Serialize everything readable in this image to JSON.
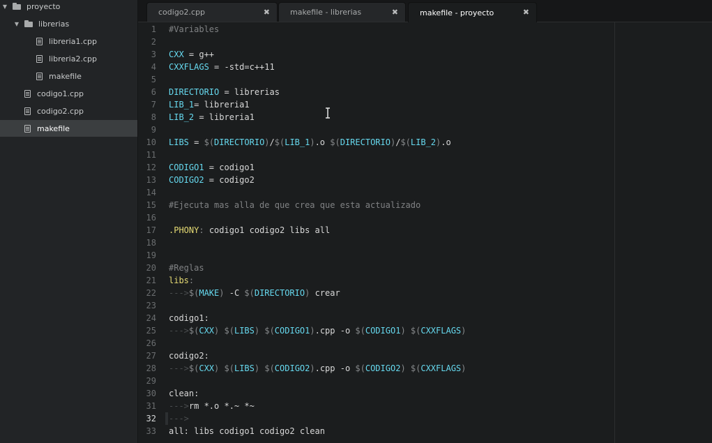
{
  "sidebar": {
    "items": [
      {
        "label": "proyecto",
        "type": "folder",
        "expanded": true,
        "depth": 0
      },
      {
        "label": "librerias",
        "type": "folder",
        "expanded": true,
        "depth": 1
      },
      {
        "label": "libreria1.cpp",
        "type": "file",
        "depth": 2
      },
      {
        "label": "libreria2.cpp",
        "type": "file",
        "depth": 2
      },
      {
        "label": "makefile",
        "type": "file",
        "depth": 2
      },
      {
        "label": "codigo1.cpp",
        "type": "file",
        "depth": 1
      },
      {
        "label": "codigo2.cpp",
        "type": "file",
        "depth": 1
      },
      {
        "label": "makefile",
        "type": "file",
        "depth": 1,
        "selected": true
      }
    ]
  },
  "tabs": [
    {
      "label": "codigo2.cpp",
      "active": false
    },
    {
      "label": "makefile - librerias",
      "active": false
    },
    {
      "label": "makefile - proyecto",
      "active": true
    }
  ],
  "close_glyph": "✖",
  "editor": {
    "current_line": 32,
    "lines": [
      "#Variables",
      "",
      "CXX = g++",
      "CXXFLAGS = -std=c++11",
      "",
      "DIRECTORIO = librerias",
      "LIB_1= libreria1",
      "LIB_2 = libreria1",
      "",
      "LIBS = $(DIRECTORIO)/$(LIB_1).o $(DIRECTORIO)/$(LIB_2).o",
      "",
      "CODIGO1 = codigo1",
      "CODIGO2 = codigo2",
      "",
      "#Ejecuta mas alla de que crea que esta actualizado",
      "",
      ".PHONY: codigo1 codigo2 libs all",
      "",
      "",
      "#Reglas",
      "libs:",
      "--->$(MAKE) -C $(DIRECTORIO) crear",
      "",
      "codigo1:",
      "--->$(CXX) $(LIBS) $(CODIGO1).cpp -o $(CODIGO1) $(CXXFLAGS)",
      "",
      "codigo2:",
      "--->$(CXX) $(LIBS) $(CODIGO2).cpp -o $(CODIGO2) $(CXXFLAGS)",
      "",
      "clean:",
      "--->rm *.o *.~ *~",
      "--->",
      "all: libs codigo1 codigo2 clean"
    ]
  },
  "colors": {
    "background": "#1b1d1e",
    "variable": "#66d9ef",
    "target": "#e6db74",
    "comment": "#808284"
  }
}
